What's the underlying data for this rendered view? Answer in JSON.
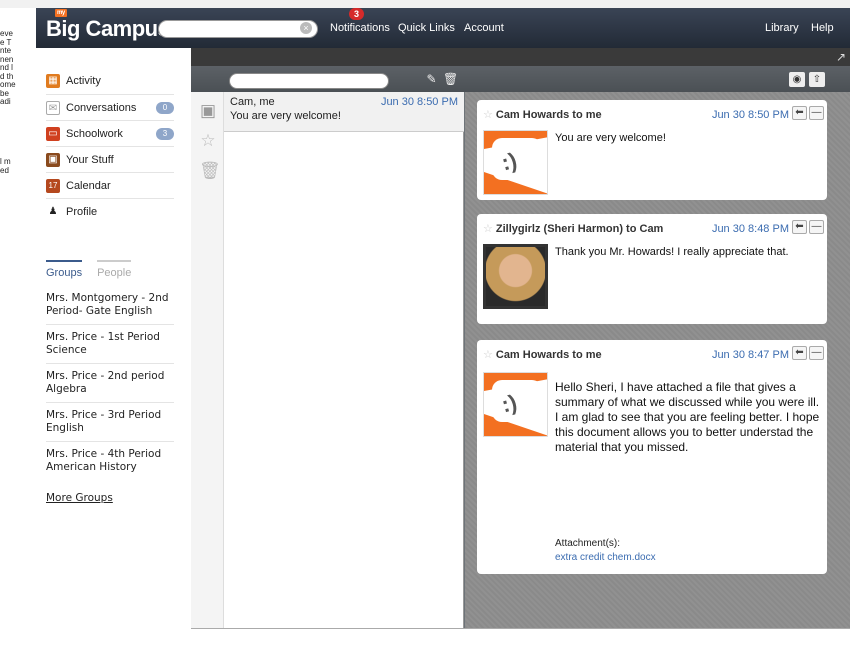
{
  "background_doc": {
    "lines": [
      "eve",
      "e T",
      "nte",
      "nen",
      "nd l",
      "d th",
      "ome",
      "be",
      "adi"
    ],
    "lines2": [
      "l m",
      "ed"
    ]
  },
  "topbar": {
    "logo_mini": "my",
    "logo": "Big Campus",
    "search_placeholder": "",
    "notifications_label": "Notifications",
    "notifications_count": "3",
    "quick_links_label": "Quick Links",
    "account_label": "Account",
    "library_label": "Library",
    "help_label": "Help"
  },
  "sidebar": {
    "items": [
      {
        "label": "Activity",
        "badge": ""
      },
      {
        "label": "Conversations",
        "badge": "0"
      },
      {
        "label": "Schoolwork",
        "badge": "3"
      },
      {
        "label": "Your Stuff",
        "badge": ""
      },
      {
        "label": "Calendar",
        "badge": ""
      },
      {
        "label": "Profile",
        "badge": ""
      }
    ],
    "tabs": {
      "groups": "Groups",
      "people": "People"
    },
    "groups": [
      "Mrs. Montgomery - 2nd Period- Gate English",
      "Mrs. Price - 1st Period Science",
      "Mrs. Price - 2nd period Algebra",
      "Mrs. Price - 3rd Period English",
      "Mrs. Price - 4th Period American History"
    ],
    "more_groups": "More Groups"
  },
  "inbox": {
    "search_placeholder": "",
    "list": [
      {
        "participants": "Cam, me",
        "time": "Jun 30 8:50 PM",
        "snippet": "You are very welcome!"
      }
    ]
  },
  "thread": {
    "messages": [
      {
        "header": "Cam Howards to me",
        "time": "Jun 30 8:50 PM",
        "body": "You are very welcome!",
        "avatar": "orange-smiley"
      },
      {
        "header": "Zillygirlz (Sheri Harmon) to Cam",
        "time": "Jun 30 8:48 PM",
        "body": "Thank you Mr. Howards! I really appreciate that.",
        "avatar": "photo"
      },
      {
        "header": "Cam Howards to me",
        "time": "Jun 30 8:47 PM",
        "body": "Hello Sheri, I have attached a file that gives a summary of what we discussed while you were ill. I am glad to see that you are feeling better. I hope this document allows you to better understad the material that you missed.",
        "avatar": "orange-smiley",
        "attachment_label": "Attachment(s):",
        "attachment_name": "extra credit chem.docx"
      }
    ]
  },
  "icons": {
    "search": "search-icon",
    "clear": "clear-icon",
    "compose": "compose-icon",
    "trash": "trash-icon",
    "star": "star-icon",
    "reply": "reply-icon",
    "minimize": "minimize-icon",
    "popout": "popout-icon"
  },
  "colors": {
    "accent_orange": "#f37021",
    "link_blue": "#3b6cb0",
    "nav_dark": "#2a3240",
    "badge": "#8fa6c9"
  }
}
